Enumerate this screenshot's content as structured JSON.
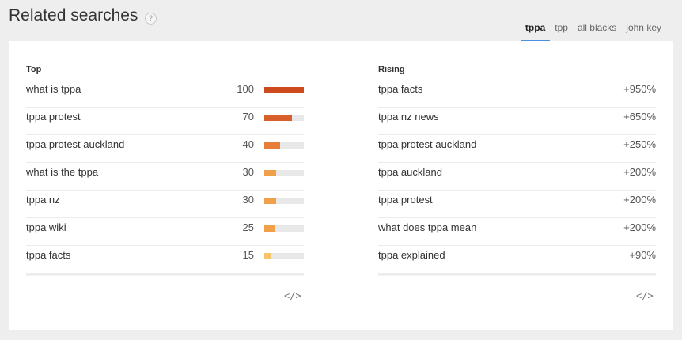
{
  "header": {
    "title": "Related searches",
    "help_icon": "?"
  },
  "tabs": [
    {
      "label": "tppa",
      "active": true
    },
    {
      "label": "tpp",
      "active": false
    },
    {
      "label": "all blacks",
      "active": false
    },
    {
      "label": "john key",
      "active": false
    }
  ],
  "colors": {
    "accent": "#4a90e2",
    "bar_high": "#cc4a1c",
    "bar_mid": "#e07b39",
    "bar_low": "#f0a04b",
    "bar_lowest": "#f6c56a"
  },
  "top": {
    "title": "Top",
    "rows": [
      {
        "label": "what is tppa",
        "value": "100",
        "level": 1.0,
        "color": "#cc4a1c"
      },
      {
        "label": "tppa protest",
        "value": "70",
        "level": 0.7,
        "color": "#d95f2a"
      },
      {
        "label": "tppa protest auckland",
        "value": "40",
        "level": 0.4,
        "color": "#e67e3a"
      },
      {
        "label": "what is the tppa",
        "value": "30",
        "level": 0.3,
        "color": "#f0a04b"
      },
      {
        "label": "tppa nz",
        "value": "30",
        "level": 0.3,
        "color": "#f0a04b"
      },
      {
        "label": "tppa wiki",
        "value": "25",
        "level": 0.25,
        "color": "#f0a04b"
      },
      {
        "label": "tppa facts",
        "value": "15",
        "level": 0.15,
        "color": "#f6c56a"
      }
    ],
    "embed_icon": "</>"
  },
  "rising": {
    "title": "Rising",
    "rows": [
      {
        "label": "tppa facts",
        "value": "+950%"
      },
      {
        "label": "tppa nz news",
        "value": "+650%"
      },
      {
        "label": "tppa protest auckland",
        "value": "+250%"
      },
      {
        "label": "tppa auckland",
        "value": "+200%"
      },
      {
        "label": "tppa protest",
        "value": "+200%"
      },
      {
        "label": "what does tppa mean",
        "value": "+200%"
      },
      {
        "label": "tppa explained",
        "value": "+90%"
      }
    ],
    "embed_icon": "</>"
  }
}
